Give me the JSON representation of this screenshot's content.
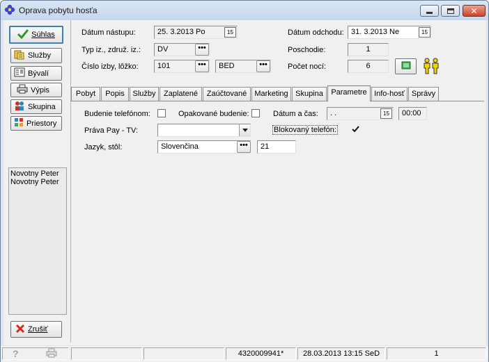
{
  "window": {
    "title": "Oprava pobytu hosťa",
    "icon": "app-flower-icon"
  },
  "left": {
    "suhlas": "Súhlas",
    "sluzby": "Služby",
    "byvali": "Bývalí",
    "vypis": "Výpis",
    "skupina": "Skupina",
    "priestory": "Priestory",
    "guests": [
      "Novotny Peter",
      "Novotny Peter"
    ],
    "zrusit": "Zrušiť"
  },
  "form": {
    "datum_nastupu_label": "Dátum nástupu:",
    "datum_nastupu_value": "25. 3.2013  Po",
    "typ_label": "Typ iz., združ. iz.:",
    "typ_value": "DV",
    "cislo_label": "Číslo izby, lôžko:",
    "cislo_value": "101",
    "lozko_value": "BED",
    "datum_odchodu_label": "Dátum odchodu:",
    "datum_odchodu_value": "31. 3.2013  Ne",
    "poschodie_label": "Poschodie:",
    "poschodie_value": "1",
    "pocet_noci_label": "Počet nocí:",
    "pocet_noci_value": "6",
    "cal_icon_text": "15"
  },
  "tabs": [
    "Pobyt",
    "Popis",
    "Služby",
    "Zaplatené",
    "Zaúčtované",
    "Marketing",
    "Skupina",
    "Parametre",
    "Info-hosť",
    "Správy"
  ],
  "active_tab": "Parametre",
  "params": {
    "budenie_label": "Budenie telefónom:",
    "budenie_checked": false,
    "opakovane_label": "Opakované budenie:",
    "opakovane_checked": false,
    "datum_cas_label": "Dátum a čas:",
    "datum_value": ". .",
    "cas_value": "00:00",
    "prava_label": "Práva Pay - TV:",
    "prava_value": "",
    "blok_label": "Blokovaný telefón:",
    "blok_checked": true,
    "jazyk_label": "Jazyk, stôl:",
    "jazyk_value": "Slovenčina",
    "stol_value": "21"
  },
  "status": {
    "c1": "",
    "c2": "",
    "c3": "",
    "c4": "4320009941*",
    "c5": "28.03.2013 13:15 SeD",
    "c6": "1"
  }
}
